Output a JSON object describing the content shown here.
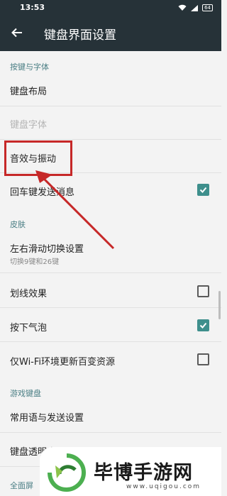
{
  "status": {
    "time": "13:53",
    "battery": "64"
  },
  "header": {
    "title": "键盘界面设置"
  },
  "sections": {
    "keys_fonts": "按键与字体",
    "skin": "皮肤",
    "game_keyboard": "游戏键盘",
    "fullscreen": "全面屏"
  },
  "rows": {
    "keyboard_layout": "键盘布局",
    "keyboard_font": "键盘字体",
    "sound_vibration": "音效与振动",
    "enter_send": "回车键发送消息",
    "swipe_switch": "左右滑动切换设置",
    "swipe_switch_sub": "切换9键和26键",
    "line_effect": "划线效果",
    "press_bubble": "按下气泡",
    "wifi_update": "仅Wi-Fi环境更新百变资源",
    "phrases_send": "常用语与发送设置",
    "keyboard_transparency": "键盘透明度"
  },
  "checkboxes": {
    "enter_send": true,
    "line_effect": false,
    "press_bubble": true,
    "wifi_update": false
  },
  "watermark": {
    "name": "毕博手游网",
    "url": "www.uqigou.com"
  },
  "colors": {
    "appbar": "#263238",
    "accent": "#3e8f8c",
    "section": "#4a7e84",
    "annotation": "#c62828"
  }
}
